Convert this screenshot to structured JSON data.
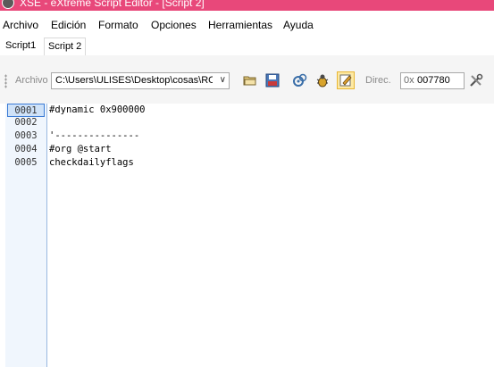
{
  "window": {
    "title": "XSE - eXtreme Script Editor - [Script 2]"
  },
  "menu": [
    "Archivo",
    "Edición",
    "Formato",
    "Opciones",
    "Herramientas",
    "Ayuda"
  ],
  "tabs": [
    {
      "label": "Script1",
      "active": false
    },
    {
      "label": "Script 2",
      "active": true
    }
  ],
  "toolbar": {
    "archivo_label": "Archivo",
    "path_value": "C:\\Users\\ULISES\\Desktop\\cosas\\ROM",
    "direc_label": "Direc.",
    "offset_prefix": "0x",
    "offset_value": "007780",
    "icons": [
      "open-folder-icon",
      "save-icon",
      "compile-icon",
      "debug-icon",
      "edit-icon",
      "settings-icon"
    ]
  },
  "editor": {
    "line_numbers": [
      "0001",
      "0002",
      "0003",
      "0004",
      "0005"
    ],
    "lines": [
      "#dynamic 0x900000",
      "",
      "'---------------",
      "#org @start",
      "checkdailyflags"
    ],
    "current_line": "0001"
  },
  "colors": {
    "titlebar": "#e8487a",
    "gutter": "#f0f6fd",
    "accent": "#3a7bd5"
  }
}
